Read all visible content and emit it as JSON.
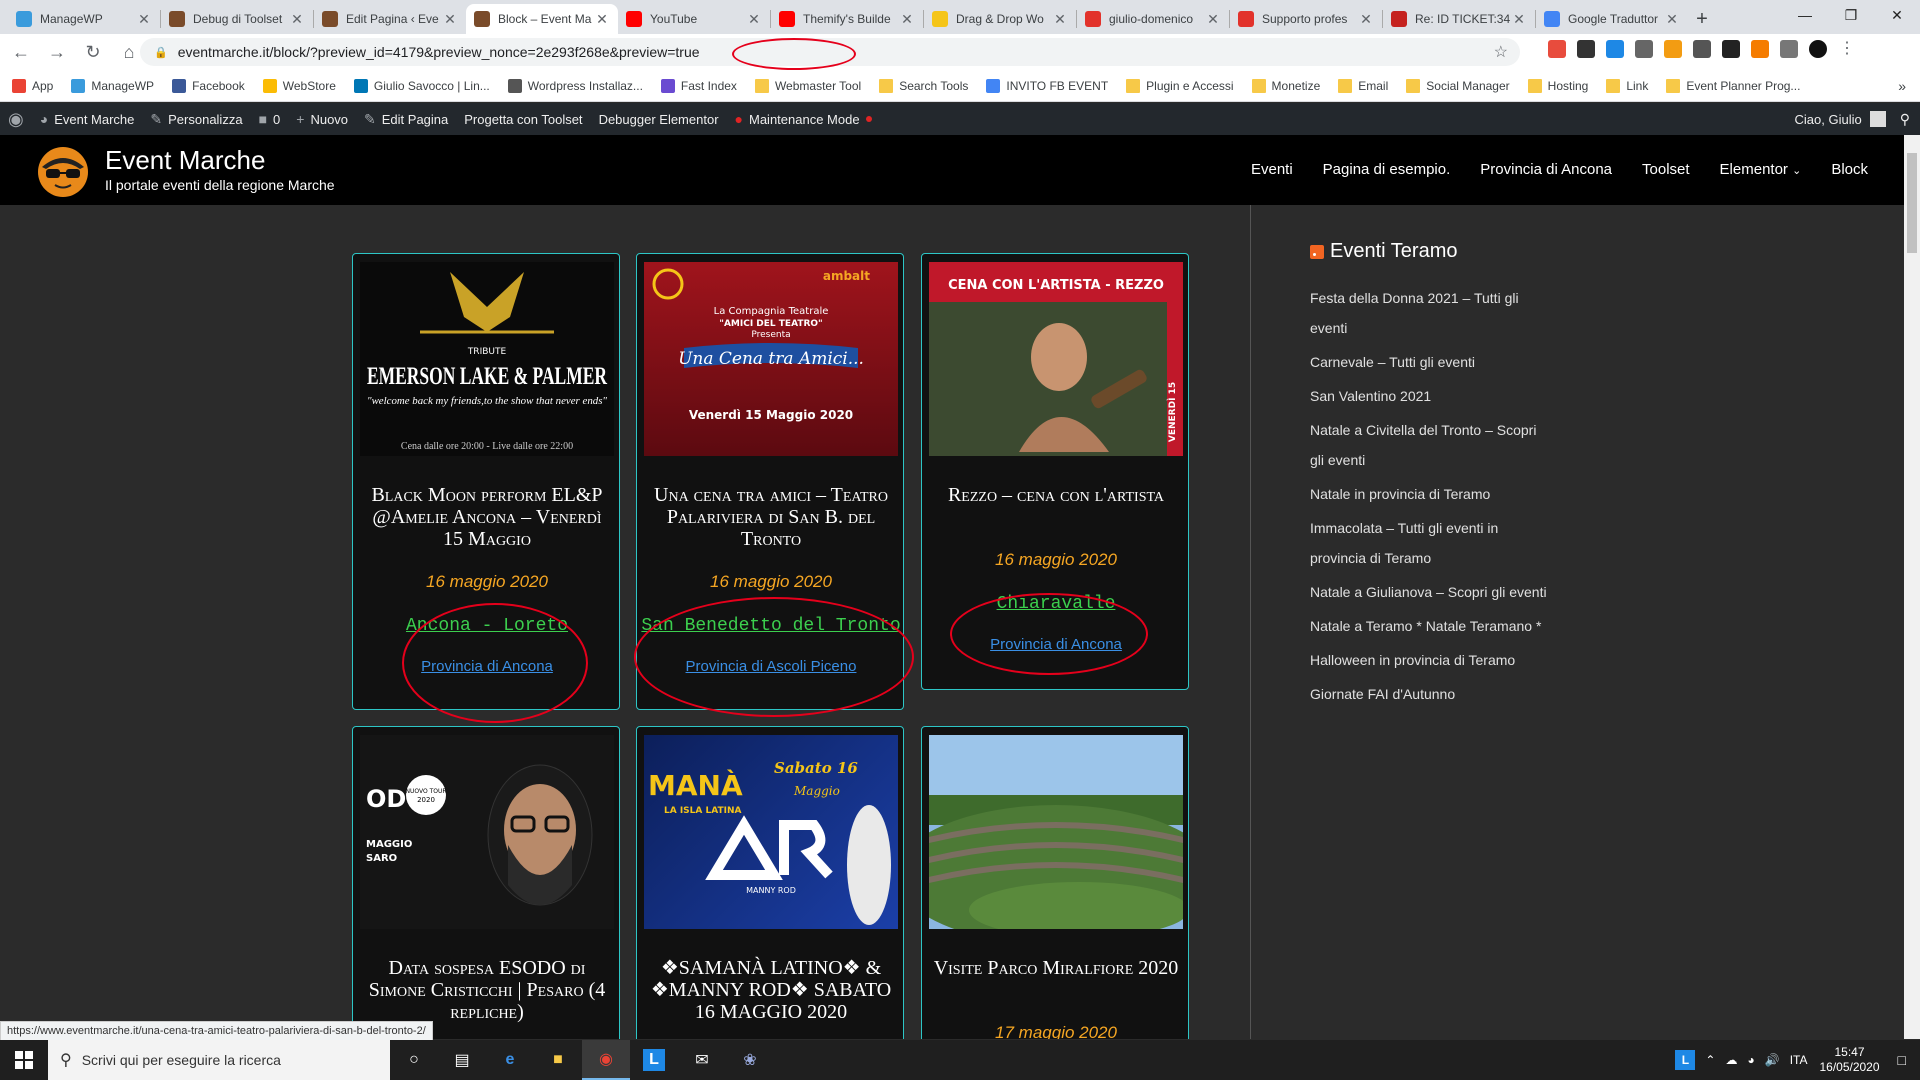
{
  "browser": {
    "tabs": [
      {
        "label": "ManageWP",
        "icon_color": "#3a9bdc",
        "active": false
      },
      {
        "label": "Debug di Toolset",
        "icon_color": "#7a4b2a",
        "active": false
      },
      {
        "label": "Edit Pagina ‹ Eve",
        "icon_color": "#7a4b2a",
        "active": false
      },
      {
        "label": "Block – Event Ma",
        "icon_color": "#7a4b2a",
        "active": true
      },
      {
        "label": "YouTube",
        "icon_color": "#ff0000",
        "active": false
      },
      {
        "label": "Themify's Builde",
        "icon_color": "#ff0000",
        "active": false
      },
      {
        "label": "Drag & Drop Wo",
        "icon_color": "#f5c518",
        "active": false
      },
      {
        "label": "giulio-domenico",
        "icon_color": "#e2322b",
        "active": false
      },
      {
        "label": "Supporto profes",
        "icon_color": "#e2322b",
        "active": false
      },
      {
        "label": "Re: ID TICKET:34",
        "icon_color": "#c5221f",
        "active": false
      },
      {
        "label": "Google Traduttor",
        "icon_color": "#4285f4",
        "active": false
      }
    ],
    "new_tab": "+",
    "url": "eventmarche.it/block/?preview_id=4179&preview_nonce=2e293f26",
    "url_highlight": "8e&preview=true",
    "bookmarks": [
      {
        "label": "App",
        "icon_color": "#ea4335",
        "folder": false
      },
      {
        "label": "ManageWP",
        "icon_color": "#3a9bdc",
        "folder": false
      },
      {
        "label": "Facebook",
        "icon_color": "#3b5998",
        "folder": false
      },
      {
        "label": "WebStore",
        "icon_color": "#fbbc05",
        "folder": false
      },
      {
        "label": "Giulio Savocco | Lin...",
        "icon_color": "#0077b5",
        "folder": false
      },
      {
        "label": "Wordpress Installaz...",
        "icon_color": "#555555",
        "folder": false
      },
      {
        "label": "Fast Index",
        "icon_color": "#6a4bd1",
        "folder": false
      },
      {
        "label": "Webmaster Tool",
        "icon_color": "#f7c948",
        "folder": true
      },
      {
        "label": "Search Tools",
        "icon_color": "#f7c948",
        "folder": true
      },
      {
        "label": "INVITO FB EVENT",
        "icon_color": "#4285f4",
        "folder": false
      },
      {
        "label": "Plugin e Accessi",
        "icon_color": "#f7c948",
        "folder": true
      },
      {
        "label": "Monetize",
        "icon_color": "#f7c948",
        "folder": true
      },
      {
        "label": "Email",
        "icon_color": "#f7c948",
        "folder": true
      },
      {
        "label": "Social Manager",
        "icon_color": "#f7c948",
        "folder": true
      },
      {
        "label": "Hosting",
        "icon_color": "#f7c948",
        "folder": true
      },
      {
        "label": "Link",
        "icon_color": "#f7c948",
        "folder": true
      },
      {
        "label": "Event Planner Prog...",
        "icon_color": "#f7c948",
        "folder": true
      }
    ],
    "bookmarks_more": "»",
    "status_url": "https://www.eventmarche.it/una-cena-tra-amici-teatro-palariviera-di-san-b-del-tronto-2/"
  },
  "adminbar": {
    "items": [
      "Event Marche",
      "Personalizza",
      "0",
      "Nuovo",
      "Edit Pagina",
      "Progetta con Toolset",
      "Debugger Elementor",
      "Maintenance Mode"
    ],
    "greeting": "Ciao, Giulio"
  },
  "site": {
    "title": "Event Marche",
    "tagline": "Il portale eventi della regione Marche",
    "nav": [
      "Eventi",
      "Pagina di esempio.",
      "Provincia di Ancona",
      "Toolset",
      "Elementor",
      "Block"
    ]
  },
  "cards": [
    {
      "title": "Black Moon perform EL&P @Amelie Ancona – Venerdì 15 Maggio",
      "date": "16 maggio 2020",
      "location": "Ancona - Loreto",
      "province": "Provincia di Ancona",
      "img_text": [
        "TRIBUTE",
        "EMERSON LAKE & PALMER",
        "\"welcome back my friends,to the show that never ends\"",
        "Cena dalle ore 20:00  -  Live dalle ore 22:00"
      ]
    },
    {
      "title": "Una cena tra amici – Teatro Palariviera di San B. del Tronto",
      "date": "16 maggio 2020",
      "location": "San Benedetto del Tronto",
      "province": "Provincia di Ascoli Piceno",
      "img_text": [
        "La Compagnia Teatrale",
        "\"AMICI DEL TEATRO\"",
        "Presenta",
        "Una Cena tra Amici...",
        "Venerdì 15 Maggio 2020",
        "ambalt"
      ]
    },
    {
      "title": "Rezzo – cena con l'artista",
      "date": "16 maggio 2020",
      "location": "Chiaravalle",
      "province": "Provincia di Ancona",
      "img_text": [
        "CENA CON L'ARTISTA - REZZO",
        "VENERDÌ 15"
      ]
    },
    {
      "title": "Data sospesa ESODO di Simone Cristicchi | Pesaro (4 repliche)",
      "date": "",
      "location": "",
      "province": "",
      "img_text": [
        "ODO",
        "NUOVO TOUR 2020",
        "MAGGIO",
        "SARO"
      ]
    },
    {
      "title": "❖SAMANÀ LATINO❖ & ❖MANNY ROD❖ SABATO 16 MAGGIO 2020",
      "date": "",
      "location": "",
      "province": "",
      "img_text": [
        "MANÀ",
        "LA ISLA LATINA",
        "Sabato 16",
        "Maggio",
        "MANNY ROD"
      ]
    },
    {
      "title": "Visite Parco Miralfiore 2020",
      "date": "17 maggio 2020",
      "location": "",
      "province": "",
      "img_text": []
    }
  ],
  "sidebar": {
    "title": "Eventi Teramo",
    "items": [
      "Festa della Donna 2021 – Tutti gli eventi",
      "Carnevale – Tutti gli eventi",
      "San Valentino 2021",
      "Natale a Civitella del Tronto – Scopri gli eventi",
      "Natale in provincia di Teramo",
      "Immacolata – Tutti gli eventi in provincia di Teramo",
      "Natale a Giulianova – Scopri gli eventi",
      "Natale a Teramo * Natale Teramano *",
      "Halloween in provincia di Teramo",
      "Giornate FAI d'Autunno"
    ]
  },
  "taskbar": {
    "search_placeholder": "Scrivi qui per eseguire la ricerca",
    "language": "ITA",
    "time": "15:47",
    "date": "16/05/2020"
  },
  "colors": {
    "accent_card_border": "#2dc6c6",
    "date": "#f5a623",
    "location": "#3ccf4e",
    "province": "#3a8fe5",
    "annotation": "#e5001b"
  }
}
